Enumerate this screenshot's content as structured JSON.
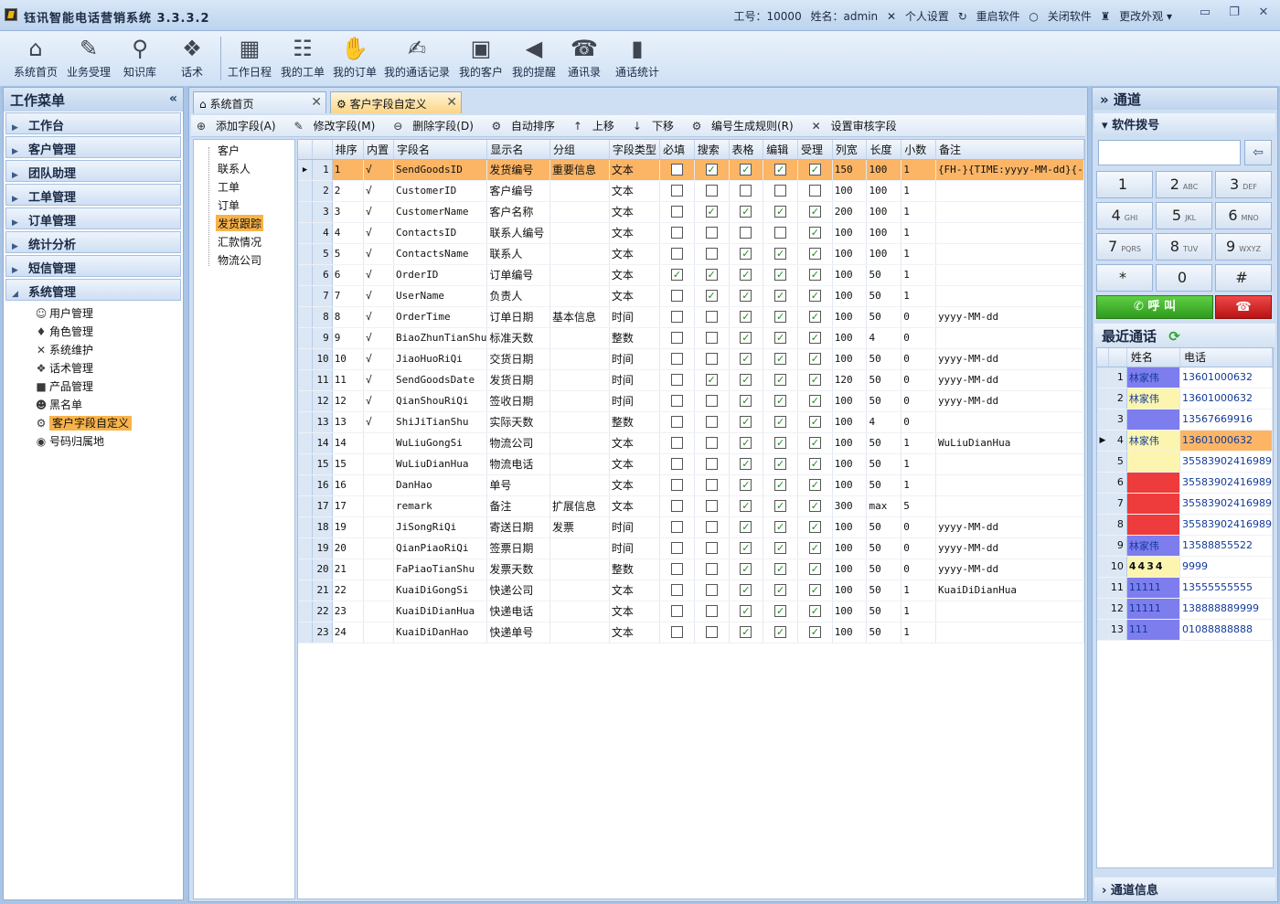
{
  "window": {
    "title": "钰讯智能电话营销系统 3.3.3.2",
    "employee_id": "工号：10000",
    "user_name": "姓名：admin",
    "personal_settings": "个人设置",
    "restart": "重启软件",
    "close": "关闭软件",
    "skin": "更改外观"
  },
  "toolbar": [
    {
      "label": "系统首页",
      "icon": "⌂"
    },
    {
      "label": "业务受理",
      "icon": "✎"
    },
    {
      "label": "知识库",
      "icon": "⚲"
    },
    {
      "label": "话术",
      "icon": "❖"
    },
    {
      "label": "工作日程",
      "icon": "▦"
    },
    {
      "label": "我的工单",
      "icon": "☷"
    },
    {
      "label": "我的订单",
      "icon": "✋"
    },
    {
      "label": "我的通话记录",
      "icon": "✍"
    },
    {
      "label": "我的客户",
      "icon": "▣"
    },
    {
      "label": "我的提醒",
      "icon": "◀"
    },
    {
      "label": "通讯录",
      "icon": "☎"
    },
    {
      "label": "通话统计",
      "icon": "▮"
    }
  ],
  "left": {
    "title": "工作菜单",
    "collapse": "«",
    "categories": [
      "工作台",
      "客户管理",
      "团队助理",
      "工单管理",
      "订单管理",
      "统计分析",
      "短信管理",
      "系统管理"
    ],
    "sub_items": [
      {
        "label": "用户管理",
        "icon": "☺"
      },
      {
        "label": "角色管理",
        "icon": "♦"
      },
      {
        "label": "系统维护",
        "icon": "✕"
      },
      {
        "label": "话术管理",
        "icon": "❖"
      },
      {
        "label": "产品管理",
        "icon": "■"
      },
      {
        "label": "黑名单",
        "icon": "☻"
      },
      {
        "label": "客户字段自定义",
        "icon": "⚙"
      },
      {
        "label": "号码归属地",
        "icon": "◉"
      }
    ]
  },
  "tabs": [
    {
      "label": "系统首页",
      "icon": "⌂",
      "close": "✕"
    },
    {
      "label": "客户字段自定义",
      "icon": "⚙",
      "close": "✕"
    }
  ],
  "actions": [
    {
      "label": "添加字段(A)",
      "icon": "⊕"
    },
    {
      "label": "修改字段(M)",
      "icon": "✎"
    },
    {
      "label": "删除字段(D)",
      "icon": "⊖"
    },
    {
      "label": "自动排序",
      "icon": "⚙"
    },
    {
      "label": "上移",
      "icon": "↑"
    },
    {
      "label": "下移",
      "icon": "↓"
    },
    {
      "label": "编号生成规则(R)",
      "icon": "⚙"
    },
    {
      "label": "设置审核字段",
      "icon": "✕"
    }
  ],
  "tree": [
    "客户",
    "联系人",
    "工单",
    "订单",
    "发货跟踪",
    "汇款情况",
    "物流公司"
  ],
  "grid": {
    "columns": [
      "排序",
      "内置",
      "字段名",
      "显示名",
      "分组",
      "字段类型",
      "必填",
      "搜索",
      "表格",
      "编辑",
      "受理",
      "列宽",
      "长度",
      "小数",
      "备注"
    ],
    "rows": [
      {
        "n": "1",
        "sort": "1",
        "builtin": "√",
        "field": "SendGoodsID",
        "display": "发货编号",
        "group": "重要信息",
        "type": "文本",
        "req": false,
        "search": true,
        "table": true,
        "edit": true,
        "accept": true,
        "width": "150",
        "len": "100",
        "dec": "1",
        "note": "{FH-}{TIME:yyyy-MM-dd}{-"
      },
      {
        "n": "2",
        "sort": "2",
        "builtin": "√",
        "field": "CustomerID",
        "display": "客户编号",
        "group": "",
        "type": "文本",
        "req": false,
        "search": false,
        "table": false,
        "edit": false,
        "accept": false,
        "width": "100",
        "len": "100",
        "dec": "1",
        "note": ""
      },
      {
        "n": "3",
        "sort": "3",
        "builtin": "√",
        "field": "CustomerName",
        "display": "客户名称",
        "group": "",
        "type": "文本",
        "req": false,
        "search": true,
        "table": true,
        "edit": true,
        "accept": true,
        "width": "200",
        "len": "100",
        "dec": "1",
        "note": ""
      },
      {
        "n": "4",
        "sort": "4",
        "builtin": "√",
        "field": "ContactsID",
        "display": "联系人编号",
        "group": "",
        "type": "文本",
        "req": false,
        "search": false,
        "table": false,
        "edit": false,
        "accept": true,
        "width": "100",
        "len": "100",
        "dec": "1",
        "note": ""
      },
      {
        "n": "5",
        "sort": "5",
        "builtin": "√",
        "field": "ContactsName",
        "display": "联系人",
        "group": "",
        "type": "文本",
        "req": false,
        "search": false,
        "table": true,
        "edit": true,
        "accept": true,
        "width": "100",
        "len": "100",
        "dec": "1",
        "note": ""
      },
      {
        "n": "6",
        "sort": "6",
        "builtin": "√",
        "field": "OrderID",
        "display": "订单编号",
        "group": "",
        "type": "文本",
        "req": true,
        "search": true,
        "table": true,
        "edit": true,
        "accept": true,
        "width": "100",
        "len": "50",
        "dec": "1",
        "note": ""
      },
      {
        "n": "7",
        "sort": "7",
        "builtin": "√",
        "field": "UserName",
        "display": "负责人",
        "group": "",
        "type": "文本",
        "req": false,
        "search": true,
        "table": true,
        "edit": true,
        "accept": true,
        "width": "100",
        "len": "50",
        "dec": "1",
        "note": ""
      },
      {
        "n": "8",
        "sort": "8",
        "builtin": "√",
        "field": "OrderTime",
        "display": "订单日期",
        "group": "基本信息",
        "type": "时间",
        "req": false,
        "search": false,
        "table": true,
        "edit": true,
        "accept": true,
        "width": "100",
        "len": "50",
        "dec": "0",
        "note": "yyyy-MM-dd"
      },
      {
        "n": "9",
        "sort": "9",
        "builtin": "√",
        "field": "BiaoZhunTianShu",
        "display": "标准天数",
        "group": "",
        "type": "整数",
        "req": false,
        "search": false,
        "table": true,
        "edit": true,
        "accept": true,
        "width": "100",
        "len": "4",
        "dec": "0",
        "note": ""
      },
      {
        "n": "10",
        "sort": "10",
        "builtin": "√",
        "field": "JiaoHuoRiQi",
        "display": "交货日期",
        "group": "",
        "type": "时间",
        "req": false,
        "search": false,
        "table": true,
        "edit": true,
        "accept": true,
        "width": "100",
        "len": "50",
        "dec": "0",
        "note": "yyyy-MM-dd"
      },
      {
        "n": "11",
        "sort": "11",
        "builtin": "√",
        "field": "SendGoodsDate",
        "display": "发货日期",
        "group": "",
        "type": "时间",
        "req": false,
        "search": true,
        "table": true,
        "edit": true,
        "accept": true,
        "width": "120",
        "len": "50",
        "dec": "0",
        "note": "yyyy-MM-dd"
      },
      {
        "n": "12",
        "sort": "12",
        "builtin": "√",
        "field": "QianShouRiQi",
        "display": "签收日期",
        "group": "",
        "type": "时间",
        "req": false,
        "search": false,
        "table": true,
        "edit": true,
        "accept": true,
        "width": "100",
        "len": "50",
        "dec": "0",
        "note": "yyyy-MM-dd"
      },
      {
        "n": "13",
        "sort": "13",
        "builtin": "√",
        "field": "ShiJiTianShu",
        "display": "实际天数",
        "group": "",
        "type": "整数",
        "req": false,
        "search": false,
        "table": true,
        "edit": true,
        "accept": true,
        "width": "100",
        "len": "4",
        "dec": "0",
        "note": ""
      },
      {
        "n": "14",
        "sort": "14",
        "builtin": "",
        "field": "WuLiuGongSi",
        "display": "物流公司",
        "group": "",
        "type": "文本",
        "req": false,
        "search": false,
        "table": true,
        "edit": true,
        "accept": true,
        "width": "100",
        "len": "50",
        "dec": "1",
        "note": "WuLiuDianHua"
      },
      {
        "n": "15",
        "sort": "15",
        "builtin": "",
        "field": "WuLiuDianHua",
        "display": "物流电话",
        "group": "",
        "type": "文本",
        "req": false,
        "search": false,
        "table": true,
        "edit": true,
        "accept": true,
        "width": "100",
        "len": "50",
        "dec": "1",
        "note": ""
      },
      {
        "n": "16",
        "sort": "16",
        "builtin": "",
        "field": "DanHao",
        "display": "单号",
        "group": "",
        "type": "文本",
        "req": false,
        "search": false,
        "table": true,
        "edit": true,
        "accept": true,
        "width": "100",
        "len": "50",
        "dec": "1",
        "note": ""
      },
      {
        "n": "17",
        "sort": "17",
        "builtin": "",
        "field": "remark",
        "display": "备注",
        "group": "扩展信息",
        "type": "文本",
        "req": false,
        "search": false,
        "table": true,
        "edit": true,
        "accept": true,
        "width": "300",
        "len": "max",
        "dec": "5",
        "note": ""
      },
      {
        "n": "18",
        "sort": "19",
        "builtin": "",
        "field": "JiSongRiQi",
        "display": "寄送日期",
        "group": "发票",
        "type": "时间",
        "req": false,
        "search": false,
        "table": true,
        "edit": true,
        "accept": true,
        "width": "100",
        "len": "50",
        "dec": "0",
        "note": "yyyy-MM-dd"
      },
      {
        "n": "19",
        "sort": "20",
        "builtin": "",
        "field": "QianPiaoRiQi",
        "display": "签票日期",
        "group": "",
        "type": "时间",
        "req": false,
        "search": false,
        "table": true,
        "edit": true,
        "accept": true,
        "width": "100",
        "len": "50",
        "dec": "0",
        "note": "yyyy-MM-dd"
      },
      {
        "n": "20",
        "sort": "21",
        "builtin": "",
        "field": "FaPiaoTianShu",
        "display": "发票天数",
        "group": "",
        "type": "整数",
        "req": false,
        "search": false,
        "table": true,
        "edit": true,
        "accept": true,
        "width": "100",
        "len": "50",
        "dec": "0",
        "note": "yyyy-MM-dd"
      },
      {
        "n": "21",
        "sort": "22",
        "builtin": "",
        "field": "KuaiDiGongSi",
        "display": "快递公司",
        "group": "",
        "type": "文本",
        "req": false,
        "search": false,
        "table": true,
        "edit": true,
        "accept": true,
        "width": "100",
        "len": "50",
        "dec": "1",
        "note": "KuaiDiDianHua"
      },
      {
        "n": "22",
        "sort": "23",
        "builtin": "",
        "field": "KuaiDiDianHua",
        "display": "快递电话",
        "group": "",
        "type": "文本",
        "req": false,
        "search": false,
        "table": true,
        "edit": true,
        "accept": true,
        "width": "100",
        "len": "50",
        "dec": "1",
        "note": ""
      },
      {
        "n": "23",
        "sort": "24",
        "builtin": "",
        "field": "KuaiDiDanHao",
        "display": "快递单号",
        "group": "",
        "type": "文本",
        "req": false,
        "search": false,
        "table": true,
        "edit": true,
        "accept": true,
        "width": "100",
        "len": "50",
        "dec": "1",
        "note": ""
      }
    ]
  },
  "right": {
    "title": "» 通道",
    "dial_title": "软件拨号",
    "backspace": "⇦",
    "keys": [
      {
        "d": "1",
        "l": ""
      },
      {
        "d": "2",
        "l": "ABC"
      },
      {
        "d": "3",
        "l": "DEF"
      },
      {
        "d": "4",
        "l": "GHI"
      },
      {
        "d": "5",
        "l": "JKL"
      },
      {
        "d": "6",
        "l": "MNO"
      },
      {
        "d": "7",
        "l": "PQRS"
      },
      {
        "d": "8",
        "l": "TUV"
      },
      {
        "d": "9",
        "l": "WXYZ"
      },
      {
        "d": "*",
        "l": ""
      },
      {
        "d": "0",
        "l": ""
      },
      {
        "d": "#",
        "l": ""
      }
    ],
    "call_label": "✆ 呼 叫",
    "hangup_label": "☎",
    "recent_title": "最近通话",
    "recent_refresh": "⟳",
    "recent_columns": [
      "姓名",
      "电话"
    ],
    "recent": [
      {
        "n": "1",
        "name": "林家伟",
        "phone": "13601000632",
        "c": "#7d7dee"
      },
      {
        "n": "2",
        "name": "林家伟",
        "phone": "13601000632",
        "c": "#fbf5b0"
      },
      {
        "n": "3",
        "name": "",
        "phone": "13567669916",
        "c": "#7d7dee"
      },
      {
        "n": "4",
        "name": "林家伟",
        "phone": "13601000632",
        "c": "#fbf5b0"
      },
      {
        "n": "5",
        "name": "",
        "phone": "35583902416989",
        "c": "#fbf5b0"
      },
      {
        "n": "6",
        "name": "",
        "phone": "35583902416989",
        "c": "#ee3b3b"
      },
      {
        "n": "7",
        "name": "",
        "phone": "35583902416989",
        "c": "#ee3b3b"
      },
      {
        "n": "8",
        "name": "",
        "phone": "35583902416989",
        "c": "#ee3b3b"
      },
      {
        "n": "9",
        "name": "林家伟",
        "phone": "13588855522",
        "c": "#7d7dee"
      },
      {
        "n": "10",
        "name": "4434",
        "phone": "9999",
        "c": "#fbf5b0"
      },
      {
        "n": "11",
        "name": "11111",
        "phone": "13555555555",
        "c": "#7d7dee"
      },
      {
        "n": "12",
        "name": "11111",
        "phone": "138888889999",
        "c": "#7d7dee"
      },
      {
        "n": "13",
        "name": "111",
        "phone": "01088888888",
        "c": "#7d7dee"
      }
    ],
    "channel_info": "通道信息"
  },
  "colors": {
    "selected_row": "#fbb565",
    "accent_orange": "#f8b34a",
    "check": "#1c8a1c"
  }
}
